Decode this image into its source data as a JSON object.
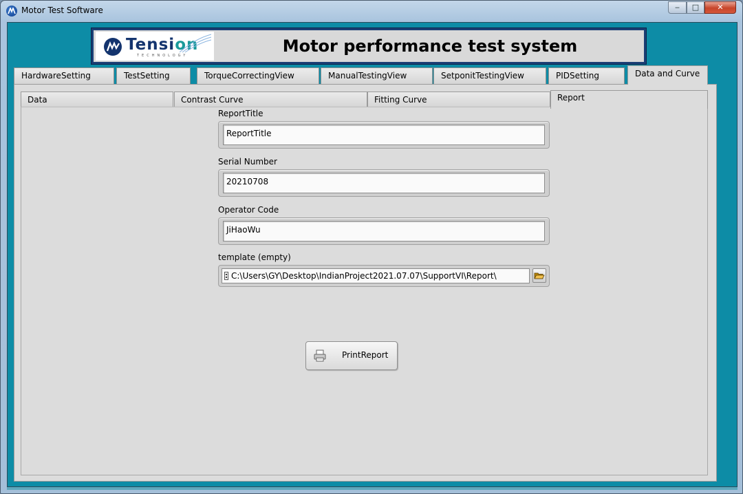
{
  "window": {
    "title": "Motor Test Software"
  },
  "header": {
    "logo_text_a": "Tensi",
    "logo_text_b": "on",
    "logo_sub": "TECHNOLOGY",
    "title": "Motor performance test system"
  },
  "tabs": [
    {
      "label": "HardwareSetting",
      "active": false
    },
    {
      "label": "TestSetting",
      "active": false
    },
    {
      "label": "TorqueCorrectingView",
      "active": false
    },
    {
      "label": "ManualTestingView",
      "active": false
    },
    {
      "label": "SetponitTestingView",
      "active": false
    },
    {
      "label": "PIDSetting",
      "active": false
    },
    {
      "label": "Data and Curve",
      "active": true
    }
  ],
  "subtabs": [
    {
      "label": "Data",
      "active": false
    },
    {
      "label": "Contrast Curve",
      "active": false
    },
    {
      "label": "Fitting Curve",
      "active": false
    },
    {
      "label": "Report",
      "active": true
    }
  ],
  "report": {
    "title_label": "ReportTitle",
    "title_value": "ReportTitle",
    "serial_label": "Serial Number",
    "serial_value": "20210708",
    "operator_label": "Operator Code",
    "operator_value": "JiHaoWu",
    "template_label": "template (empty)",
    "template_path": "C:\\Users\\GY\\Desktop\\IndianProject2021.07.07\\SupportVI\\Report\\",
    "print_label": "PrintReport"
  },
  "colors": {
    "accent": "#0d8ca6",
    "header_border": "#1b3f75",
    "panel": "#dcdcdc"
  },
  "icons": [
    "minimize-icon",
    "maximize-icon",
    "close-icon",
    "folder-open-icon",
    "printer-icon",
    "path-icon"
  ]
}
